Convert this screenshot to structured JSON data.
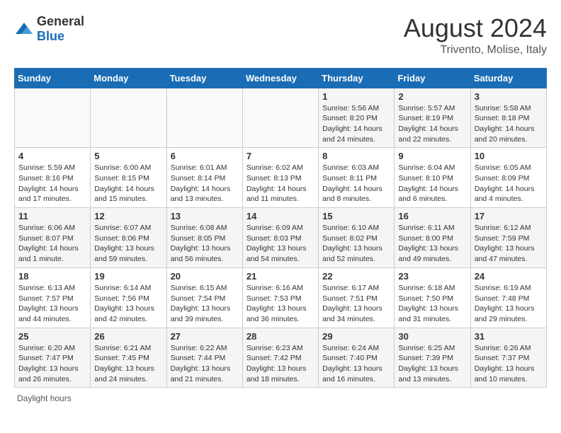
{
  "header": {
    "logo_general": "General",
    "logo_blue": "Blue",
    "month_title": "August 2024",
    "location": "Trivento, Molise, Italy"
  },
  "days_of_week": [
    "Sunday",
    "Monday",
    "Tuesday",
    "Wednesday",
    "Thursday",
    "Friday",
    "Saturday"
  ],
  "weeks": [
    [
      {
        "date": "",
        "info": ""
      },
      {
        "date": "",
        "info": ""
      },
      {
        "date": "",
        "info": ""
      },
      {
        "date": "",
        "info": ""
      },
      {
        "date": "1",
        "info": "Sunrise: 5:56 AM\nSunset: 8:20 PM\nDaylight: 14 hours and 24 minutes."
      },
      {
        "date": "2",
        "info": "Sunrise: 5:57 AM\nSunset: 8:19 PM\nDaylight: 14 hours and 22 minutes."
      },
      {
        "date": "3",
        "info": "Sunrise: 5:58 AM\nSunset: 8:18 PM\nDaylight: 14 hours and 20 minutes."
      }
    ],
    [
      {
        "date": "4",
        "info": "Sunrise: 5:59 AM\nSunset: 8:16 PM\nDaylight: 14 hours and 17 minutes."
      },
      {
        "date": "5",
        "info": "Sunrise: 6:00 AM\nSunset: 8:15 PM\nDaylight: 14 hours and 15 minutes."
      },
      {
        "date": "6",
        "info": "Sunrise: 6:01 AM\nSunset: 8:14 PM\nDaylight: 14 hours and 13 minutes."
      },
      {
        "date": "7",
        "info": "Sunrise: 6:02 AM\nSunset: 8:13 PM\nDaylight: 14 hours and 11 minutes."
      },
      {
        "date": "8",
        "info": "Sunrise: 6:03 AM\nSunset: 8:11 PM\nDaylight: 14 hours and 8 minutes."
      },
      {
        "date": "9",
        "info": "Sunrise: 6:04 AM\nSunset: 8:10 PM\nDaylight: 14 hours and 6 minutes."
      },
      {
        "date": "10",
        "info": "Sunrise: 6:05 AM\nSunset: 8:09 PM\nDaylight: 14 hours and 4 minutes."
      }
    ],
    [
      {
        "date": "11",
        "info": "Sunrise: 6:06 AM\nSunset: 8:07 PM\nDaylight: 14 hours and 1 minute."
      },
      {
        "date": "12",
        "info": "Sunrise: 6:07 AM\nSunset: 8:06 PM\nDaylight: 13 hours and 59 minutes."
      },
      {
        "date": "13",
        "info": "Sunrise: 6:08 AM\nSunset: 8:05 PM\nDaylight: 13 hours and 56 minutes."
      },
      {
        "date": "14",
        "info": "Sunrise: 6:09 AM\nSunset: 8:03 PM\nDaylight: 13 hours and 54 minutes."
      },
      {
        "date": "15",
        "info": "Sunrise: 6:10 AM\nSunset: 8:02 PM\nDaylight: 13 hours and 52 minutes."
      },
      {
        "date": "16",
        "info": "Sunrise: 6:11 AM\nSunset: 8:00 PM\nDaylight: 13 hours and 49 minutes."
      },
      {
        "date": "17",
        "info": "Sunrise: 6:12 AM\nSunset: 7:59 PM\nDaylight: 13 hours and 47 minutes."
      }
    ],
    [
      {
        "date": "18",
        "info": "Sunrise: 6:13 AM\nSunset: 7:57 PM\nDaylight: 13 hours and 44 minutes."
      },
      {
        "date": "19",
        "info": "Sunrise: 6:14 AM\nSunset: 7:56 PM\nDaylight: 13 hours and 42 minutes."
      },
      {
        "date": "20",
        "info": "Sunrise: 6:15 AM\nSunset: 7:54 PM\nDaylight: 13 hours and 39 minutes."
      },
      {
        "date": "21",
        "info": "Sunrise: 6:16 AM\nSunset: 7:53 PM\nDaylight: 13 hours and 36 minutes."
      },
      {
        "date": "22",
        "info": "Sunrise: 6:17 AM\nSunset: 7:51 PM\nDaylight: 13 hours and 34 minutes."
      },
      {
        "date": "23",
        "info": "Sunrise: 6:18 AM\nSunset: 7:50 PM\nDaylight: 13 hours and 31 minutes."
      },
      {
        "date": "24",
        "info": "Sunrise: 6:19 AM\nSunset: 7:48 PM\nDaylight: 13 hours and 29 minutes."
      }
    ],
    [
      {
        "date": "25",
        "info": "Sunrise: 6:20 AM\nSunset: 7:47 PM\nDaylight: 13 hours and 26 minutes."
      },
      {
        "date": "26",
        "info": "Sunrise: 6:21 AM\nSunset: 7:45 PM\nDaylight: 13 hours and 24 minutes."
      },
      {
        "date": "27",
        "info": "Sunrise: 6:22 AM\nSunset: 7:44 PM\nDaylight: 13 hours and 21 minutes."
      },
      {
        "date": "28",
        "info": "Sunrise: 6:23 AM\nSunset: 7:42 PM\nDaylight: 13 hours and 18 minutes."
      },
      {
        "date": "29",
        "info": "Sunrise: 6:24 AM\nSunset: 7:40 PM\nDaylight: 13 hours and 16 minutes."
      },
      {
        "date": "30",
        "info": "Sunrise: 6:25 AM\nSunset: 7:39 PM\nDaylight: 13 hours and 13 minutes."
      },
      {
        "date": "31",
        "info": "Sunrise: 6:26 AM\nSunset: 7:37 PM\nDaylight: 13 hours and 10 minutes."
      }
    ]
  ],
  "footer": {
    "daylight_label": "Daylight hours"
  }
}
